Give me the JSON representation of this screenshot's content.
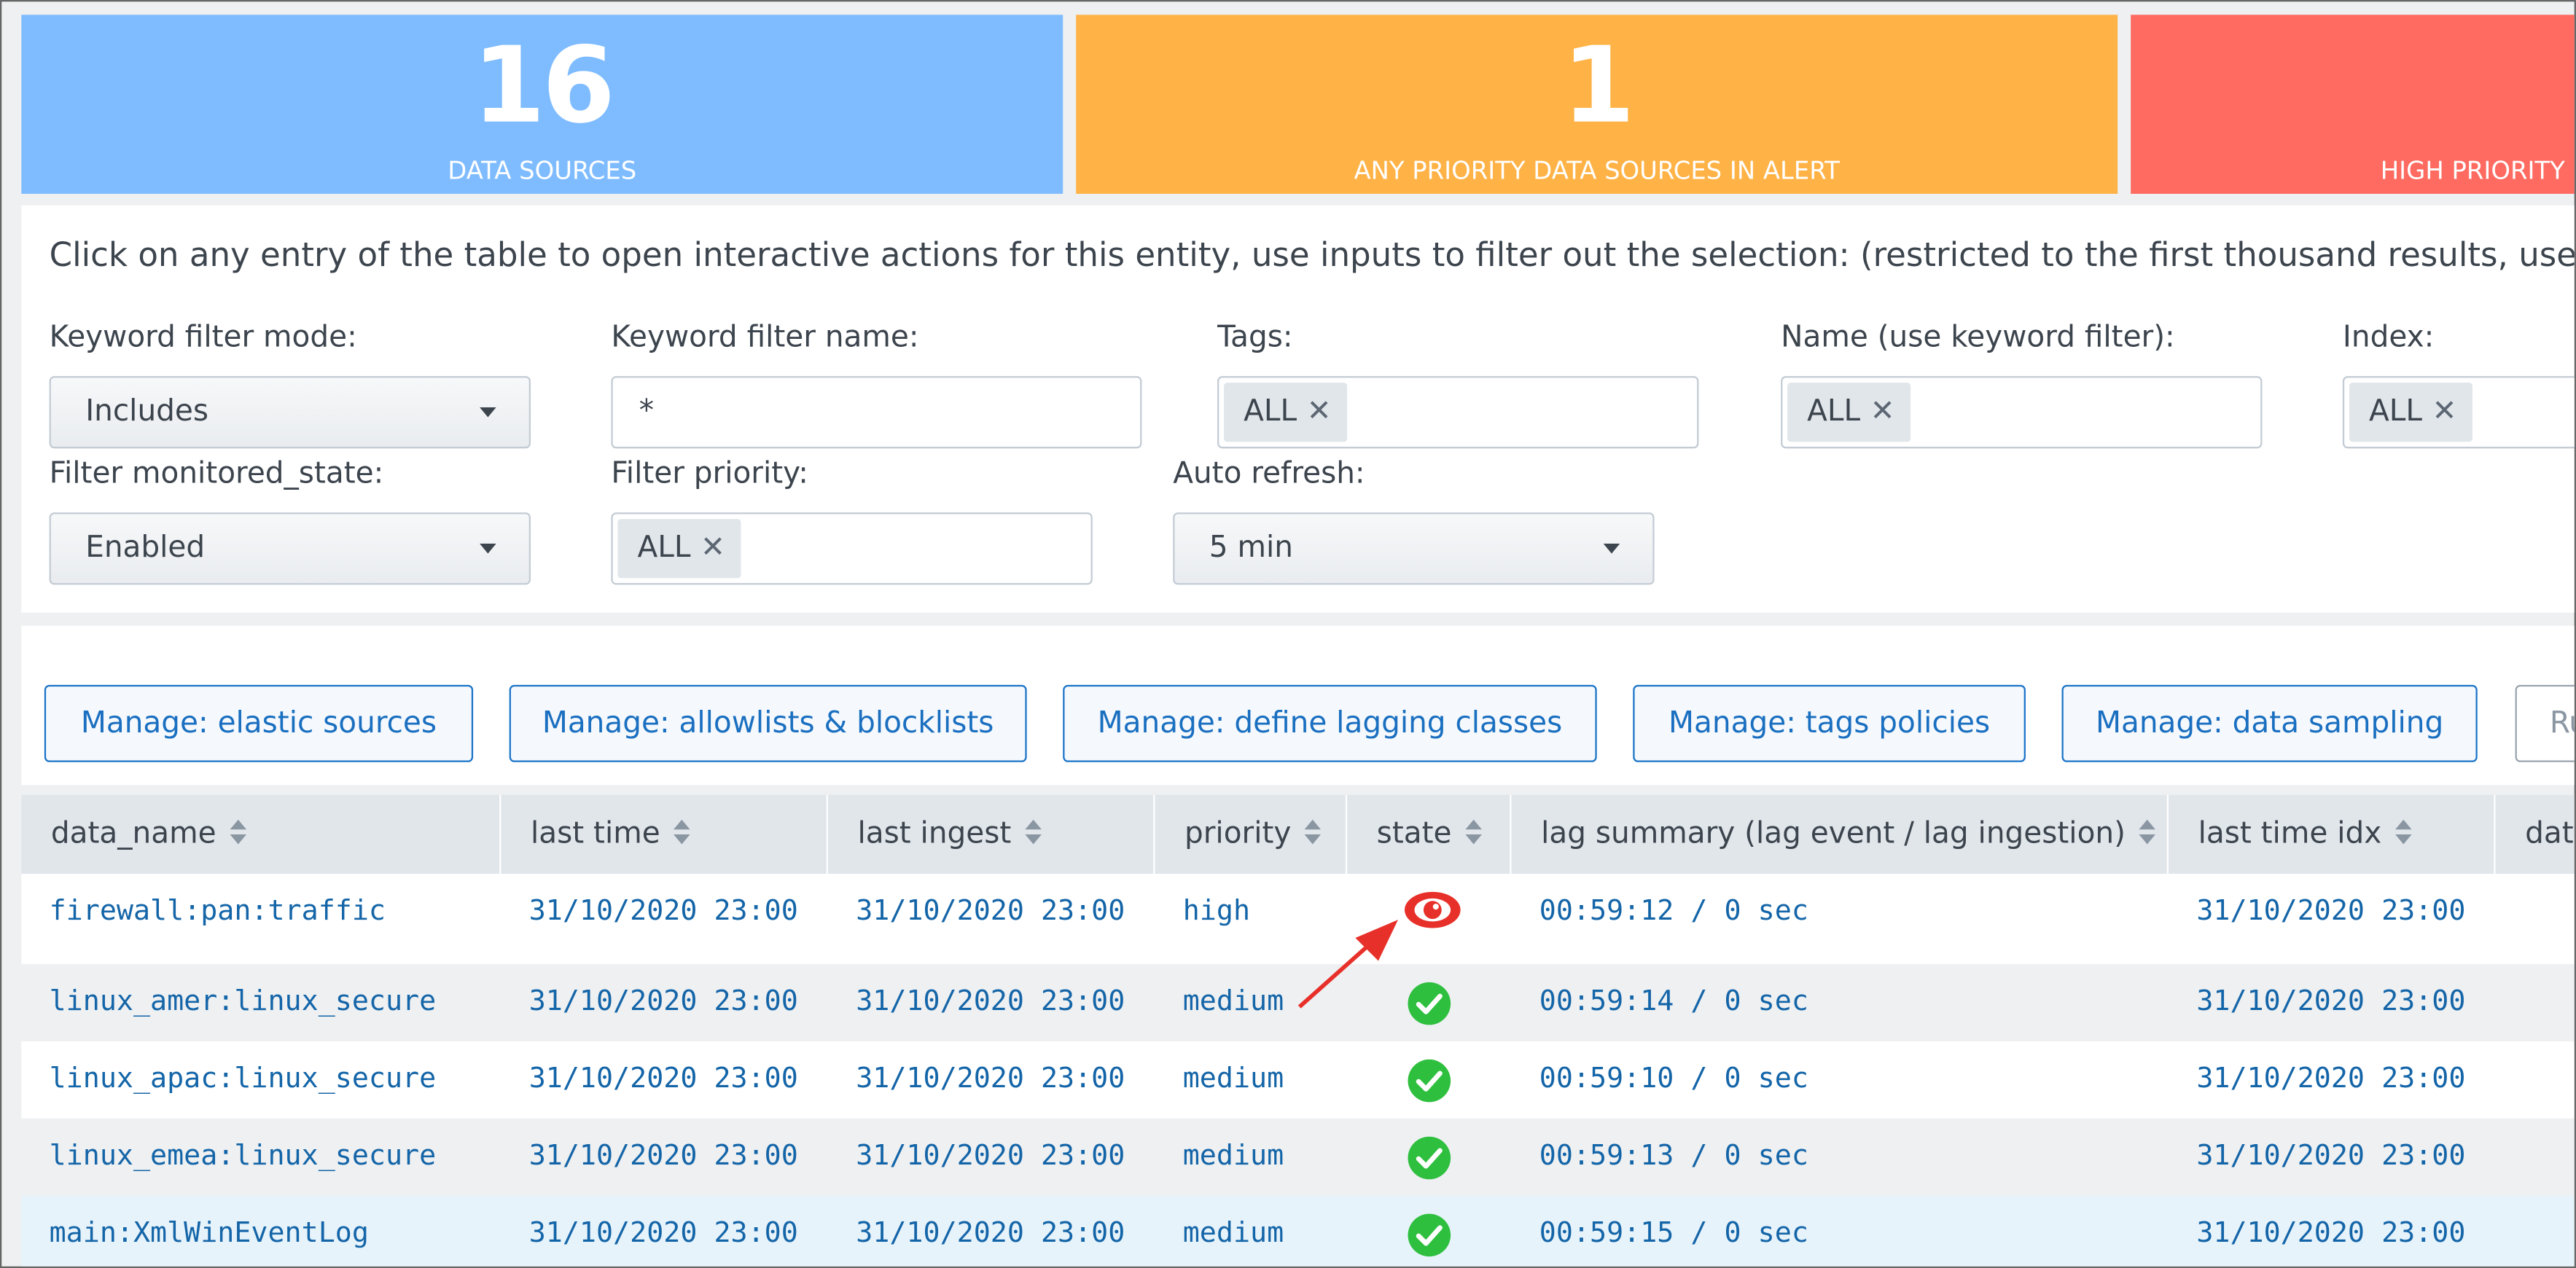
{
  "kpis": [
    {
      "value": "16",
      "label": "DATA SOURCES",
      "color": "#7fbcff"
    },
    {
      "value": "1",
      "label": "ANY PRIORITY DATA SOURCES IN ALERT",
      "color": "#ffb347"
    },
    {
      "value": "",
      "label": "HIGH PRIORITY",
      "color": "#ff6b61"
    }
  ],
  "intro": "Click on any entry of the table to open interactive actions for this entity, use inputs to filter out the selection: (restricted to the first thousand results, use",
  "filters": {
    "keyword_mode": {
      "label": "Keyword filter mode:",
      "value": "Includes"
    },
    "keyword_name": {
      "label": "Keyword filter name:",
      "value": "*"
    },
    "tags": {
      "label": "Tags:",
      "chip": "ALL"
    },
    "name": {
      "label": "Name (use keyword filter):",
      "chip": "ALL"
    },
    "index": {
      "label": "Index:",
      "chip": "ALL"
    },
    "monitored_state": {
      "label": "Filter monitored_state:",
      "value": "Enabled"
    },
    "priority": {
      "label": "Filter priority:",
      "chip": "ALL"
    },
    "auto_refresh": {
      "label": "Auto refresh:",
      "value": "5 min"
    }
  },
  "chip_remove": "✕",
  "buttons": {
    "elastic": "Manage: elastic sources",
    "allow": "Manage: allowlists & blocklists",
    "lagging": "Manage: define lagging classes",
    "tags": "Manage: tags policies",
    "sampling": "Manage: data sampling",
    "more": "Ru"
  },
  "columns": {
    "data_name": "data_name",
    "last_time": "last time",
    "last_ingest": "last ingest",
    "priority": "priority",
    "state": "state",
    "lag": "lag summary (lag event / lag ingestion)",
    "last_idx": "last time idx",
    "more": "data"
  },
  "rows": [
    {
      "data_name": "firewall:pan:traffic",
      "last_time": "31/10/2020 23:00",
      "last_ingest": "31/10/2020 23:00",
      "priority": "high",
      "state": "red-eye-icon",
      "lag": "00:59:12 / 0 sec",
      "last_idx": "31/10/2020 23:00"
    },
    {
      "data_name": "linux_amer:linux_secure",
      "last_time": "31/10/2020 23:00",
      "last_ingest": "31/10/2020 23:00",
      "priority": "medium",
      "state": "green-check-icon",
      "lag": "00:59:14 / 0 sec",
      "last_idx": "31/10/2020 23:00"
    },
    {
      "data_name": "linux_apac:linux_secure",
      "last_time": "31/10/2020 23:00",
      "last_ingest": "31/10/2020 23:00",
      "priority": "medium",
      "state": "green-check-icon",
      "lag": "00:59:10 / 0 sec",
      "last_idx": "31/10/2020 23:00"
    },
    {
      "data_name": "linux_emea:linux_secure",
      "last_time": "31/10/2020 23:00",
      "last_ingest": "31/10/2020 23:00",
      "priority": "medium",
      "state": "green-check-icon",
      "lag": "00:59:13 / 0 sec",
      "last_idx": "31/10/2020 23:00"
    },
    {
      "data_name": "main:XmlWinEventLog",
      "last_time": "31/10/2020 23:00",
      "last_ingest": "31/10/2020 23:00",
      "priority": "medium",
      "state": "green-check-icon",
      "lag": "00:59:15 / 0 sec",
      "last_idx": "31/10/2020 23:00"
    }
  ],
  "colors": {
    "link_text": "#1465a8",
    "button_border": "#1a73c8",
    "state_ok": "#2fbf3f",
    "state_alert": "#e8302a",
    "annotation_arrow": "#e8302a"
  }
}
